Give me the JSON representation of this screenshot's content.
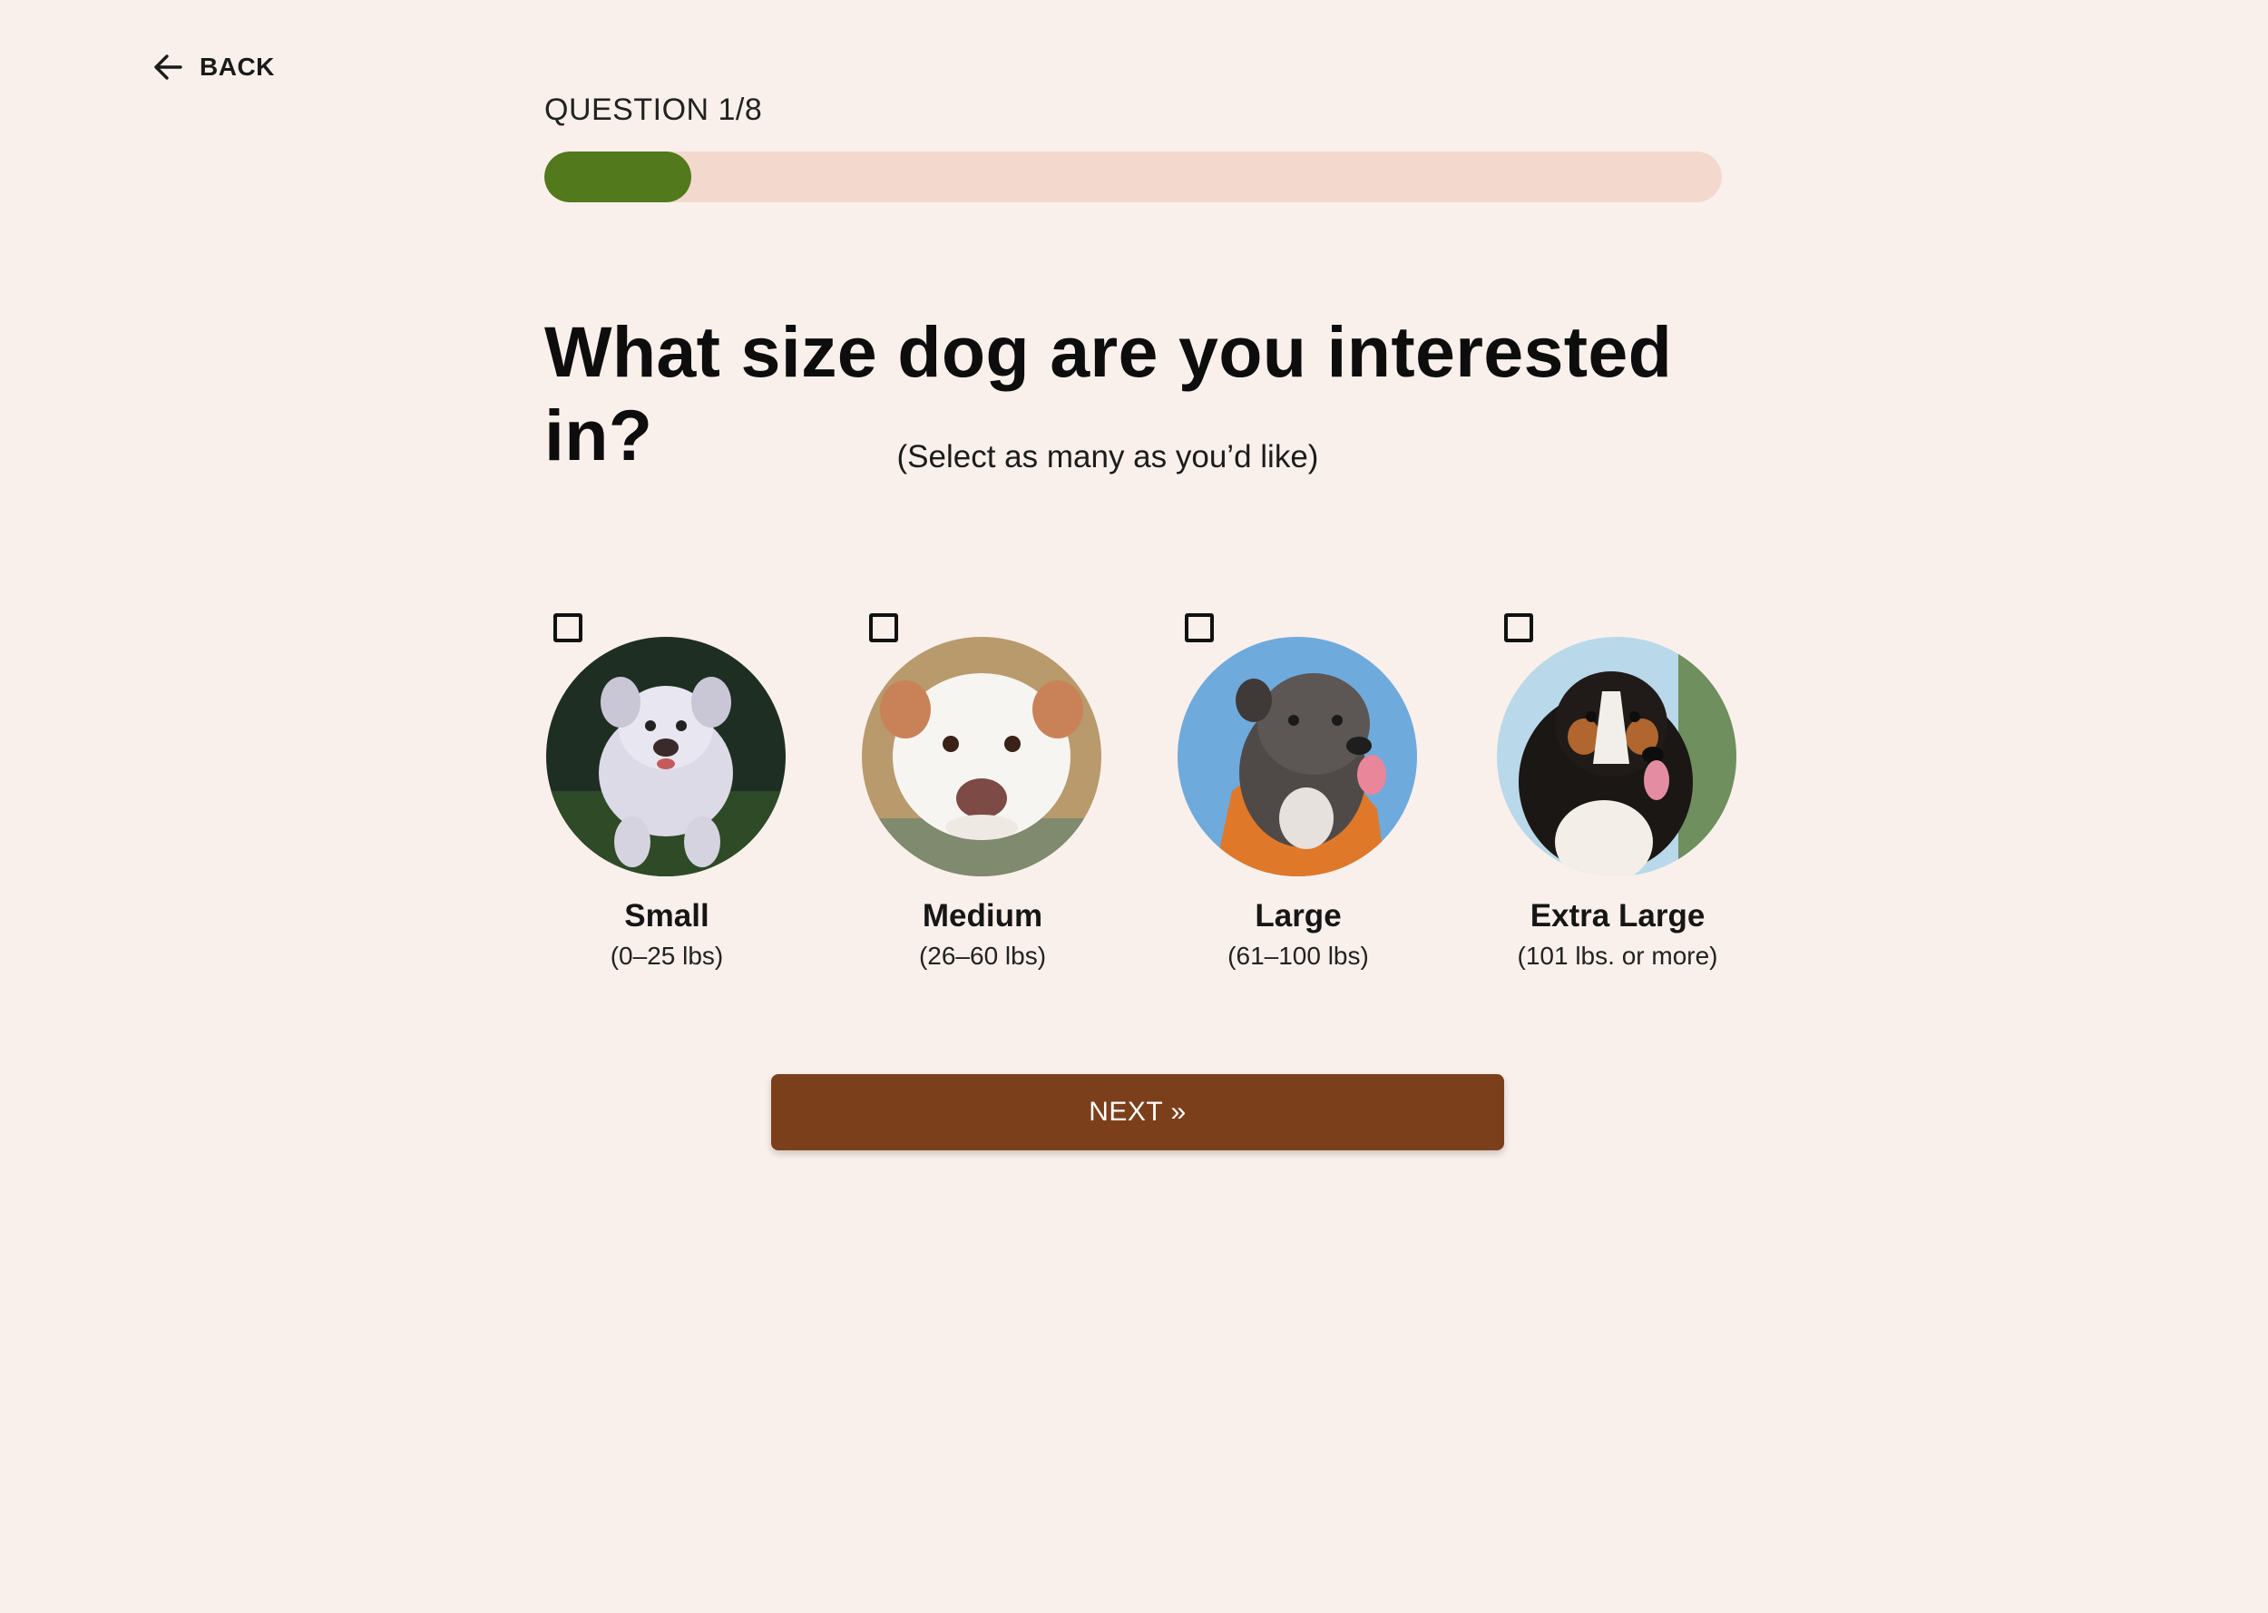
{
  "back": {
    "label": "BACK",
    "icon": "arrow-left-icon"
  },
  "progress": {
    "label": "QUESTION 1/8",
    "current": 1,
    "total": 8,
    "fraction": 0.125,
    "fill_color": "#52791C",
    "track_color": "#F3D8CE"
  },
  "question": {
    "title": "What size dog are you interested in?",
    "subtitle": "(Select as many as you’d like)"
  },
  "options": [
    {
      "name": "Small",
      "range": "(0–25 lbs)",
      "checked": false
    },
    {
      "name": "Medium",
      "range": "(26–60 lbs)",
      "checked": false
    },
    {
      "name": "Large",
      "range": "(61–100 lbs)",
      "checked": false
    },
    {
      "name": "Extra Large",
      "range": "(101 lbs. or more)",
      "checked": false
    }
  ],
  "next_button": {
    "label": "NEXT »",
    "color": "#7C3F1B"
  },
  "colors": {
    "background": "#FAF0EB"
  }
}
